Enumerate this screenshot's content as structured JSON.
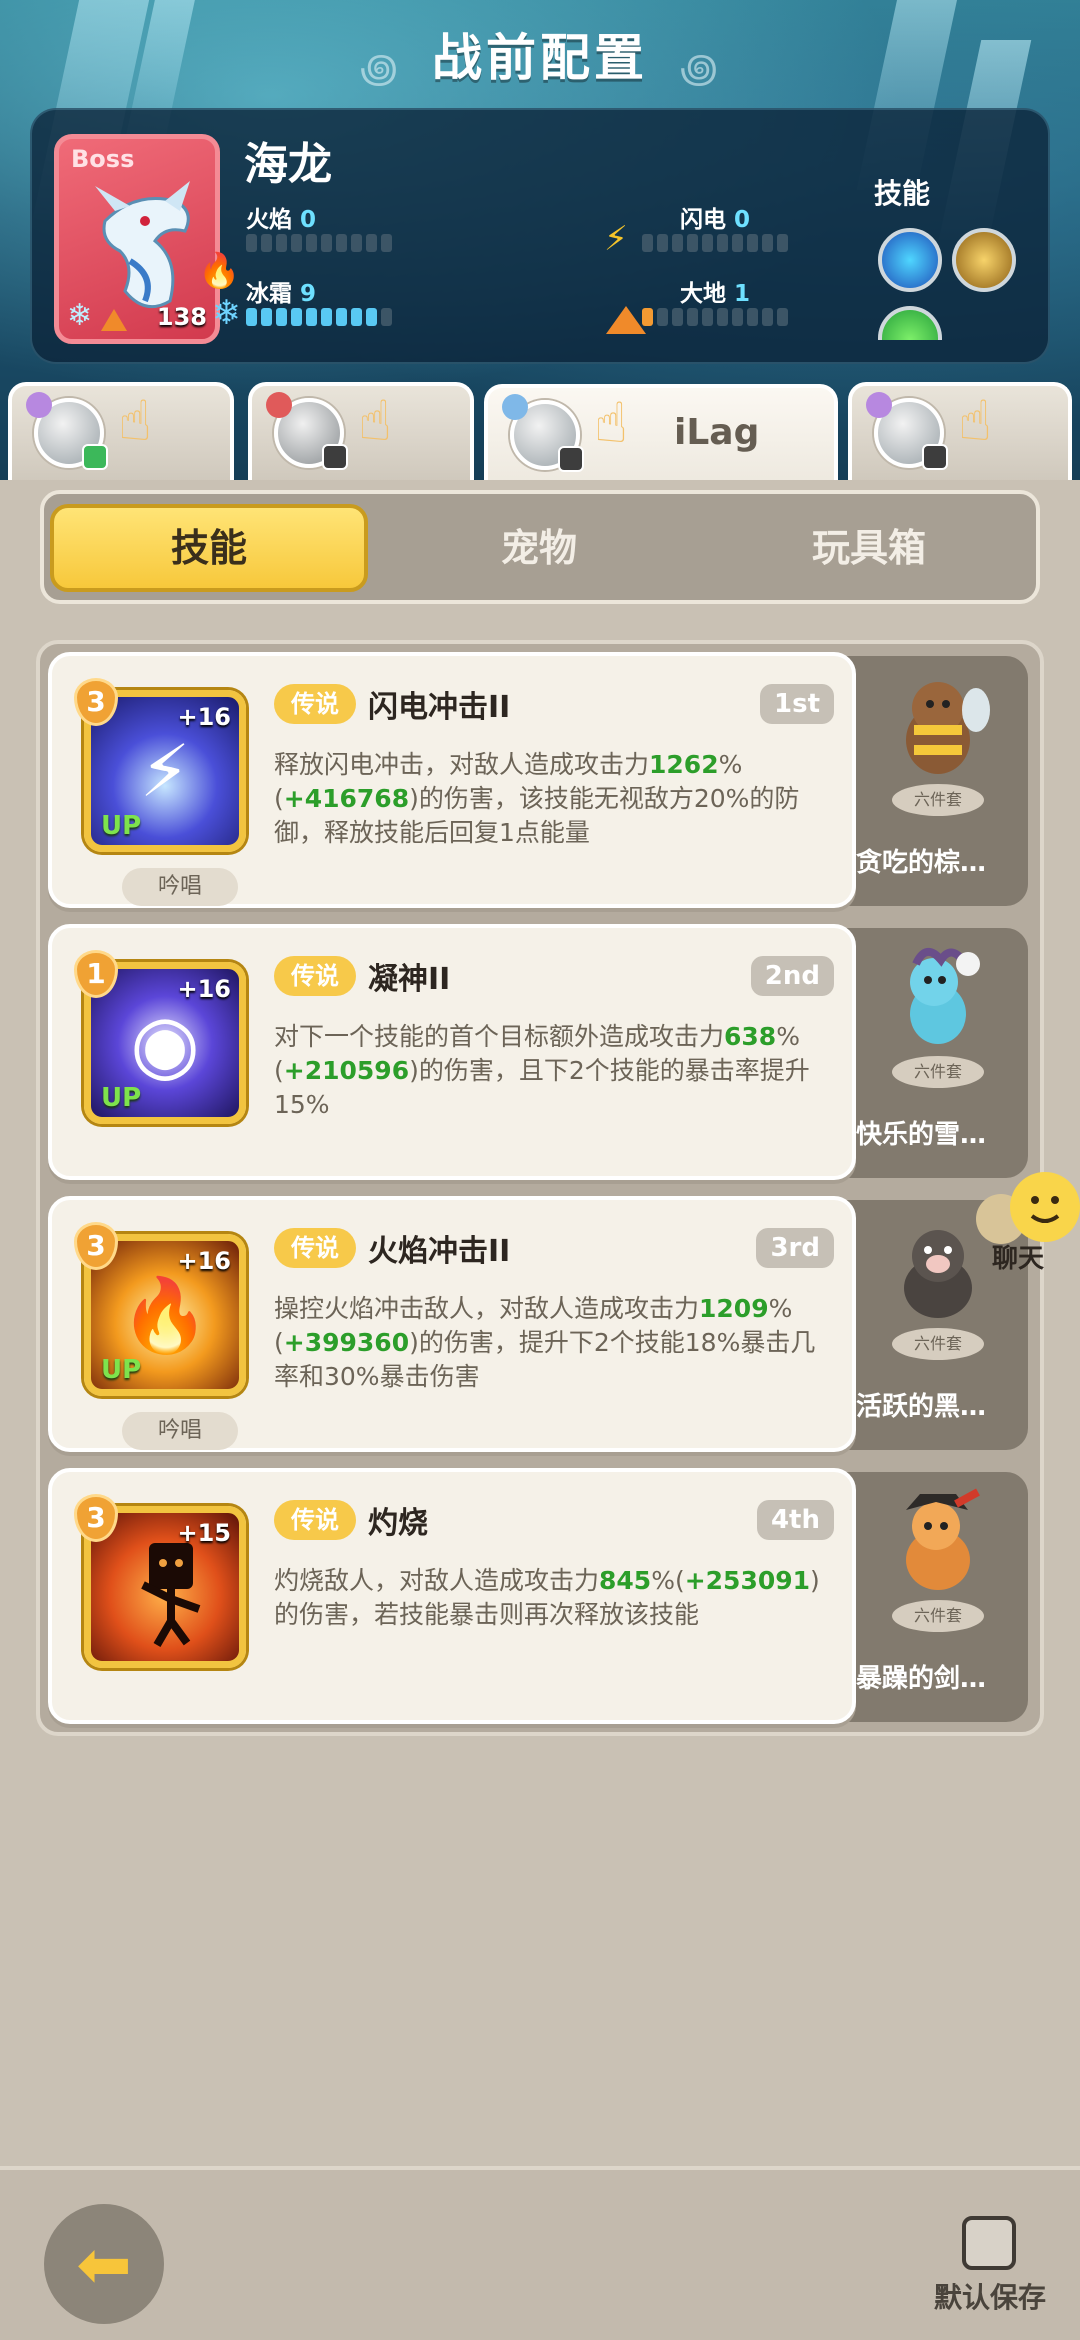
{
  "header": {
    "title": "战前配置"
  },
  "boss": {
    "tag": "Boss",
    "name": "海龙",
    "level": "138",
    "elements": [
      {
        "key": "fire",
        "label": "火焰",
        "value": "0",
        "level": 0
      },
      {
        "key": "thunder",
        "label": "闪电",
        "value": "0",
        "level": 0
      },
      {
        "key": "ice",
        "label": "冰霜",
        "value": "9",
        "level": 9
      },
      {
        "key": "earth",
        "label": "大地",
        "value": "1",
        "level": 1
      }
    ],
    "skills_label": "技能"
  },
  "players": [
    {
      "name": ""
    },
    {
      "name": ""
    },
    {
      "name": "iLag"
    },
    {
      "name": ""
    }
  ],
  "tabs": {
    "skills": "技能",
    "pets": "宠物",
    "toys": "玩具箱"
  },
  "skills": [
    {
      "rank": "3",
      "plus": "+16",
      "up": "UP",
      "tag": "传说",
      "name": "闪电冲击II",
      "order": "1st",
      "chant": "吟唱",
      "desc_a": "释放闪电冲击，对敌人造成攻击力",
      "desc_b": "1262",
      "desc_c": "%(",
      "desc_d": "+416768",
      "desc_e": ")的伤害，该技能无视敌方20%的防御，释放技能后回复1点能量",
      "pet_set": "六件套",
      "pet_name": "贪吃的棕…"
    },
    {
      "rank": "1",
      "plus": "+16",
      "up": "UP",
      "tag": "传说",
      "name": "凝神II",
      "order": "2nd",
      "chant": "",
      "desc_a": "对下一个技能的首个目标额外造成攻击力",
      "desc_b": "638",
      "desc_c": "%(",
      "desc_d": "+210596",
      "desc_e": ")的伤害，且下2个技能的暴击率提升15%",
      "pet_set": "六件套",
      "pet_name": "快乐的雪…"
    },
    {
      "rank": "3",
      "plus": "+16",
      "up": "UP",
      "tag": "传说",
      "name": "火焰冲击II",
      "order": "3rd",
      "chant": "吟唱",
      "desc_a": "操控火焰冲击敌人，对敌人造成攻击力",
      "desc_b": "1209",
      "desc_c": "%(",
      "desc_d": "+399360",
      "desc_e": ")的伤害，提升下2个技能18%暴击几率和30%暴击伤害",
      "pet_set": "六件套",
      "pet_name": "活跃的黑…"
    },
    {
      "rank": "3",
      "plus": "+15",
      "up": "",
      "tag": "传说",
      "name": "灼烧",
      "order": "4th",
      "chant": "",
      "desc_a": "灼烧敌人，对敌人造成攻击力",
      "desc_b": "845",
      "desc_c": "%(",
      "desc_d": "+253091",
      "desc_e": ")的伤害，若技能暴击则再次释放该技能",
      "pet_set": "六件套",
      "pet_name": "暴躁的剑…"
    }
  ],
  "chat": {
    "label": "聊天"
  },
  "footer": {
    "save_label": "默认保存"
  },
  "colors": {
    "accent_yellow": "#f7c83b",
    "desc_green": "#2c9e2a",
    "ice_blue": "#59c9f3"
  }
}
